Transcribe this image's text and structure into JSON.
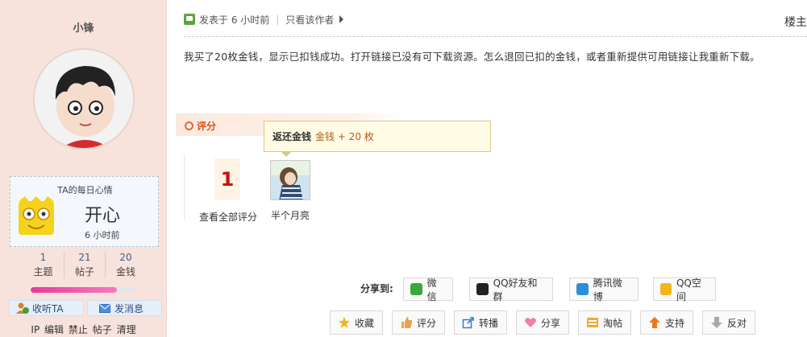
{
  "user": {
    "name": "小锋",
    "mood_title": "TA的每日心情",
    "mood": "开心",
    "mood_time": "6 小时前",
    "stats": [
      {
        "num": "1",
        "label": "主题"
      },
      {
        "num": "21",
        "label": "帖子"
      },
      {
        "num": "20",
        "label": "金钱"
      }
    ],
    "level_progress": 0.82,
    "follow_label": "收听TA",
    "message_label": "发消息",
    "admin_links": [
      "IP",
      "编辑",
      "禁止",
      "帖子",
      "清理"
    ]
  },
  "post": {
    "posted_label": "发表于 6 小时前",
    "author_only_label": "只看该作者",
    "floor": "楼主",
    "content": "我买了20枚金钱，显示已扣钱成功。打开链接已没有可下载资源。怎么退回已扣的金钱，或者重新提供可用链接让我重新下载。"
  },
  "rating": {
    "label": "评分",
    "score": "1",
    "view_all_label": "查看全部评分",
    "tooltip_title": "返还金钱",
    "tooltip_reward": "金钱 + 20 枚",
    "rater_name": "半个月亮"
  },
  "share": {
    "label": "分享到:",
    "items": [
      {
        "label": "微信",
        "icon": "wechat-icon",
        "color": "#3aa83a"
      },
      {
        "label": "QQ好友和群",
        "icon": "qq-icon",
        "color": "#222222"
      },
      {
        "label": "腾讯微博",
        "icon": "tencent-weibo-icon",
        "color": "#2a8fd6"
      },
      {
        "label": "QQ空间",
        "icon": "qzone-icon",
        "color": "#f2b51d"
      }
    ]
  },
  "actions": [
    {
      "label": "收藏",
      "icon": "star-icon"
    },
    {
      "label": "评分",
      "icon": "thumb-icon"
    },
    {
      "label": "转播",
      "icon": "forward-icon"
    },
    {
      "label": "分享",
      "icon": "heart-icon"
    },
    {
      "label": "淘帖",
      "icon": "folder-icon"
    },
    {
      "label": "支持",
      "icon": "arrow-up-icon"
    },
    {
      "label": "反对",
      "icon": "arrow-down-icon"
    }
  ]
}
